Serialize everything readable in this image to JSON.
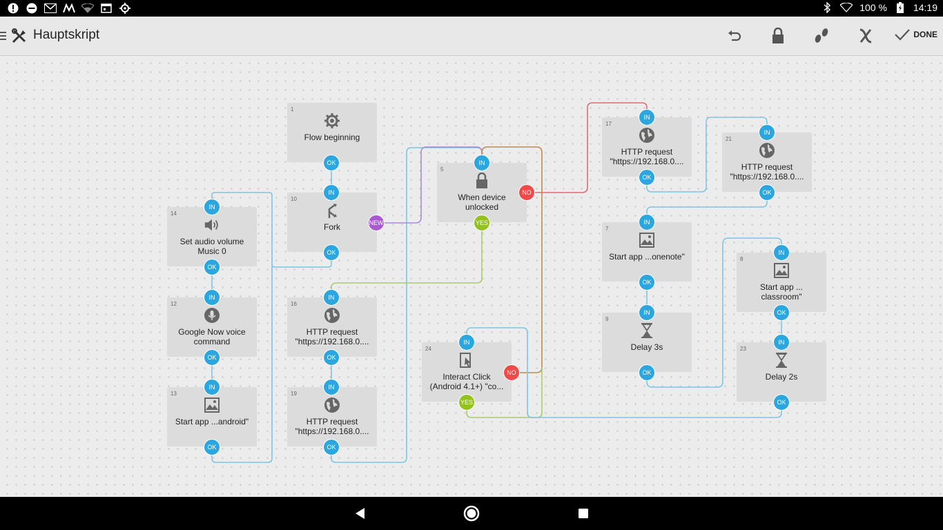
{
  "statusbar": {
    "left_icons": [
      "alert-icon",
      "do-not-disturb-icon",
      "gmail-icon",
      "m-app-icon",
      "wifi-icon",
      "calendar-icon",
      "settings-icon"
    ],
    "battery": "100 %",
    "time": "14:19"
  },
  "toolbar": {
    "title": "Hauptskript",
    "done_label": "DONE"
  },
  "blocks": [
    {
      "id": "b1",
      "num": "1",
      "line1": "Flow beginning",
      "line2": "",
      "icon": "gear-icon"
    },
    {
      "id": "b10",
      "num": "10",
      "line1": "Fork",
      "line2": "",
      "icon": "fork-icon"
    },
    {
      "id": "b14",
      "num": "14",
      "line1": "Set audio volume",
      "line2": "Music 0",
      "icon": "speaker-icon"
    },
    {
      "id": "b12",
      "num": "12",
      "line1": "Google Now voice",
      "line2": "command",
      "icon": "microphone-icon"
    },
    {
      "id": "b13",
      "num": "13",
      "line1": "Start app ...android\"",
      "line2": "",
      "icon": "app-image-icon"
    },
    {
      "id": "b16",
      "num": "16",
      "line1": "HTTP request",
      "line2": "\"https://192.168.0....",
      "icon": "globe-icon"
    },
    {
      "id": "b19",
      "num": "19",
      "line1": "HTTP request",
      "line2": "\"https://192.168.0....",
      "icon": "globe-icon"
    },
    {
      "id": "b5",
      "num": "5",
      "line1": "When device",
      "line2": "unlocked",
      "icon": "lock-icon"
    },
    {
      "id": "b24",
      "num": "24",
      "line1": "Interact Click",
      "line2": "(Android 4.1+) \"co...",
      "icon": "touch-icon"
    },
    {
      "id": "b17",
      "num": "17",
      "line1": "HTTP request",
      "line2": "\"https://192.168.0....",
      "icon": "globe-icon"
    },
    {
      "id": "b21",
      "num": "21",
      "line1": "HTTP request",
      "line2": "\"https://192.168.0....",
      "icon": "globe-icon"
    },
    {
      "id": "b7",
      "num": "7",
      "line1": "Start app ...onenote\"",
      "line2": "",
      "icon": "app-image-icon"
    },
    {
      "id": "b9",
      "num": "9",
      "line1": "Delay 3s",
      "line2": "",
      "icon": "hourglass-icon"
    },
    {
      "id": "b8",
      "num": "8",
      "line1": "Start app ...",
      "line2": "classroom\"",
      "icon": "app-image-icon"
    },
    {
      "id": "b23",
      "num": "23",
      "line1": "Delay 2s",
      "line2": "",
      "icon": "hourglass-icon"
    }
  ],
  "ports": {
    "in": "IN",
    "ok": "OK",
    "new": "NEW",
    "no": "NO",
    "yes": "YES"
  },
  "colors": {
    "port_blue": "#2ba6de",
    "port_red": "#ef4a4a",
    "port_green": "#93c21e",
    "port_purple": "#a95ad0",
    "wire_blue": "#7ec4e4",
    "wire_red": "#e06a6a",
    "wire_green": "#a8cc6a",
    "wire_purple": "#a98ad8",
    "wire_brown": "#c08a4a"
  }
}
